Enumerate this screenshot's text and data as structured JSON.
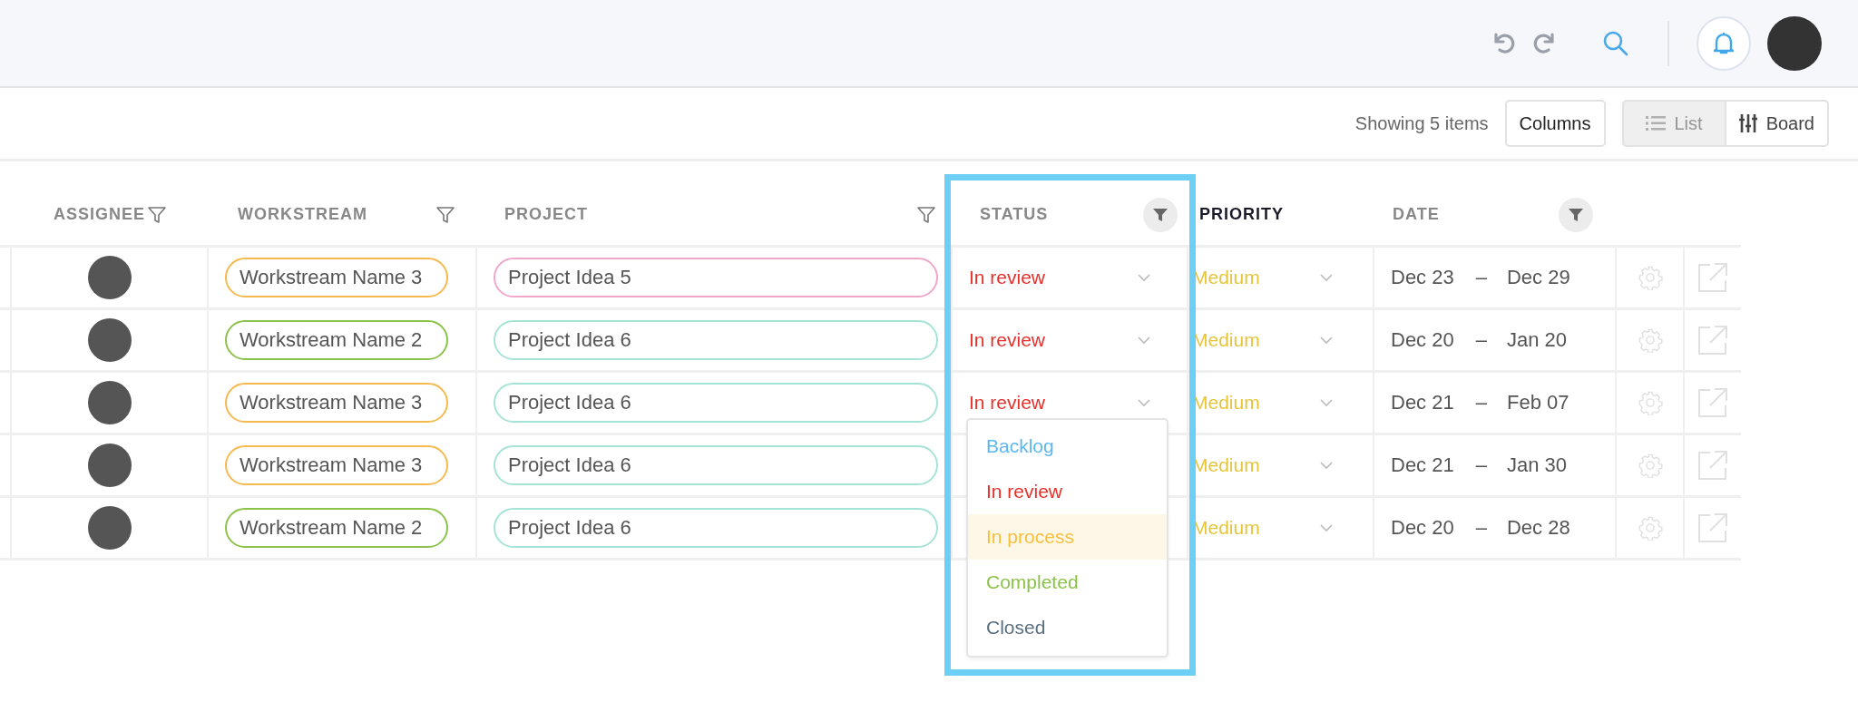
{
  "toolbar": {
    "count": "Showing 5 items",
    "columns_button": "Columns",
    "views": [
      {
        "label": "List",
        "kind": "list",
        "selected": true
      },
      {
        "label": "Board",
        "kind": "board",
        "selected": false
      }
    ]
  },
  "table": {
    "columns": [
      {
        "label": "ASSIGNEE",
        "filter": true,
        "filtered": false,
        "sorted": false
      },
      {
        "label": "WORKSTREAM",
        "filter": true,
        "filtered": false,
        "sorted": false
      },
      {
        "label": "PROJECT",
        "filter": true,
        "filtered": false,
        "sorted": false
      },
      {
        "label": "STATUS",
        "filter": true,
        "filtered": true,
        "sorted": false
      },
      {
        "label": "PRIORITY",
        "filter": false,
        "filtered": false,
        "sorted": true
      },
      {
        "label": "DATE",
        "filter": true,
        "filtered": true,
        "sorted": false
      }
    ],
    "rows": [
      {
        "workstream": {
          "label": "Workstream Name 3",
          "color": "#f5b94e"
        },
        "project": {
          "label": "Project Idea 5",
          "color": "#f0a6c8"
        },
        "status": {
          "label": "In review",
          "color": "#e8302a"
        },
        "priority": {
          "label": "Medium",
          "color": "#e6c53a"
        },
        "start": "Dec 23",
        "dash": "–",
        "end": "Dec 29"
      },
      {
        "workstream": {
          "label": "Workstream Name 2",
          "color": "#8bc34a"
        },
        "project": {
          "label": "Project Idea 6",
          "color": "#a6e3d7"
        },
        "status": {
          "label": "In review",
          "color": "#e8302a"
        },
        "priority": {
          "label": "Medium",
          "color": "#e6c53a"
        },
        "start": "Dec 20",
        "dash": "–",
        "end": "Jan 20"
      },
      {
        "workstream": {
          "label": "Workstream Name 3",
          "color": "#f5b94e"
        },
        "project": {
          "label": "Project Idea 6",
          "color": "#a6e3d7"
        },
        "status": {
          "label": "In review",
          "color": "#e8302a",
          "options": [
            {
              "label": "Backlog",
              "color": "#5cb8f0",
              "selected": false
            },
            {
              "label": "In review",
              "color": "#e8302a",
              "selected": false
            },
            {
              "label": "In process",
              "color": "#f9bf3b",
              "selected": true
            },
            {
              "label": "Completed",
              "color": "#8bc34a",
              "selected": false
            },
            {
              "label": "Closed",
              "color": "#5a6f80",
              "selected": false
            }
          ]
        },
        "priority": {
          "label": "Medium",
          "color": "#e6c53a"
        },
        "start": "Dec 21",
        "dash": "–",
        "end": "Feb 07"
      },
      {
        "workstream": {
          "label": "Workstream Name 3",
          "color": "#f5b94e"
        },
        "project": {
          "label": "Project Idea 6",
          "color": "#a6e3d7"
        },
        "priority": {
          "label": "Medium",
          "color": "#e6c53a"
        },
        "start": "Dec 21",
        "dash": "–",
        "end": "Jan 30"
      },
      {
        "workstream": {
          "label": "Workstream Name 2",
          "color": "#8bc34a"
        },
        "project": {
          "label": "Project Idea 6",
          "color": "#a6e3d7"
        },
        "priority": {
          "label": "Medium",
          "color": "#e6c53a"
        },
        "start": "Dec 20",
        "dash": "–",
        "end": "Dec 28"
      }
    ]
  }
}
